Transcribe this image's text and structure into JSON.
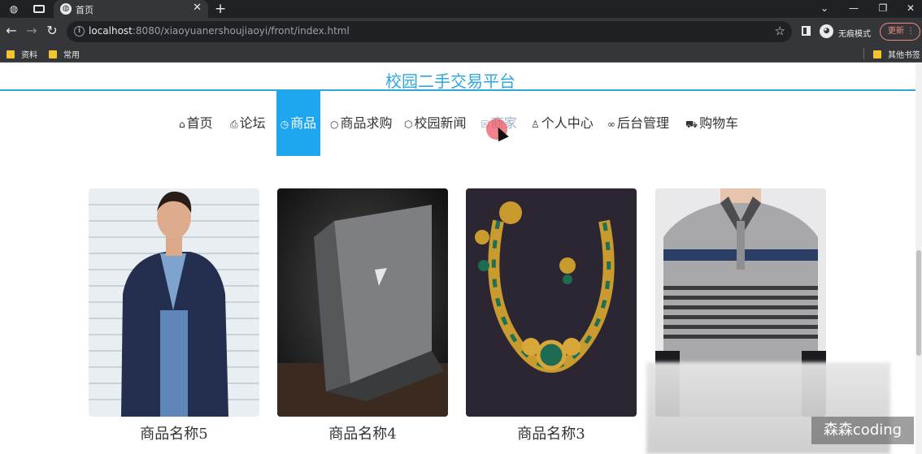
{
  "browser": {
    "tab_title": "首页",
    "tab_close": "✕",
    "new_tab": "+",
    "url_host": "localhost",
    "url_rest": ":8080/xiaoyuanershoujiaoyi/front/index.html",
    "incognito_label": "无痕模式",
    "update_label": "更新",
    "bookmarks": [
      "资料",
      "常用"
    ],
    "other_bookmarks": "其他书签"
  },
  "site": {
    "title": "校园二手交易平台",
    "nav": [
      {
        "label": "首页",
        "icon": "home-icon",
        "glyph": "⌂"
      },
      {
        "label": "论坛",
        "icon": "forum-icon",
        "glyph": "⎙"
      },
      {
        "label": "商品",
        "icon": "clock-icon",
        "glyph": "◷",
        "active": true
      },
      {
        "label": "商品求购",
        "icon": "circle-icon",
        "glyph": "○"
      },
      {
        "label": "校园新闻",
        "icon": "cube-icon",
        "glyph": "⬡"
      },
      {
        "label": "商家",
        "icon": "store-icon",
        "glyph": "☒"
      },
      {
        "label": "个人中心",
        "icon": "user-icon",
        "glyph": "♙"
      },
      {
        "label": "后台管理",
        "icon": "link-icon",
        "glyph": "∞"
      },
      {
        "label": "购物车",
        "icon": "cart-icon",
        "glyph": "⛟"
      }
    ],
    "products": [
      {
        "name": "商品名称5",
        "image": "man-in-navy-jacket"
      },
      {
        "name": "商品名称4",
        "image": "gray-laptop"
      },
      {
        "name": "商品名称3",
        "image": "gold-green-necklace"
      },
      {
        "name": "",
        "image": "striped-polo-shirt"
      }
    ],
    "watermark": "森森coding",
    "colors": {
      "accent": "#1ea7ef",
      "title": "#2ea7e0"
    }
  }
}
